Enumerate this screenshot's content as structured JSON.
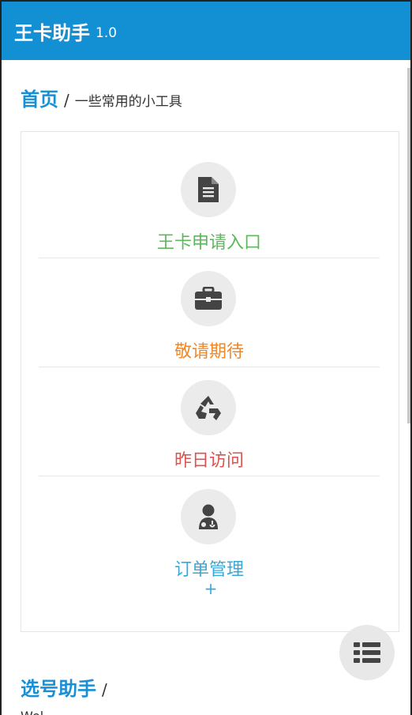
{
  "app": {
    "title": "王卡助手",
    "version": "1.0"
  },
  "section1": {
    "title": "首页",
    "separator": "/",
    "subtitle": "一些常用的小工具"
  },
  "tools": [
    {
      "label": "王卡申请入口",
      "icon": "document-icon",
      "color": "#5cb85c"
    },
    {
      "label": "敬请期待",
      "icon": "briefcase-icon",
      "color": "#f0872a"
    },
    {
      "label": "昨日访问",
      "icon": "recycle-icon",
      "color": "#d9534f"
    },
    {
      "label": "订单管理",
      "icon": "user-doctor-icon",
      "color": "#35a9d9"
    }
  ],
  "more": {
    "label": "+"
  },
  "section2": {
    "title": "选号助手",
    "separator": "/"
  },
  "partial_text": "Wel",
  "fab": {
    "icon": "list-icon"
  },
  "colors": {
    "primary": "#138fd4",
    "accent": "#1a8fd6"
  }
}
